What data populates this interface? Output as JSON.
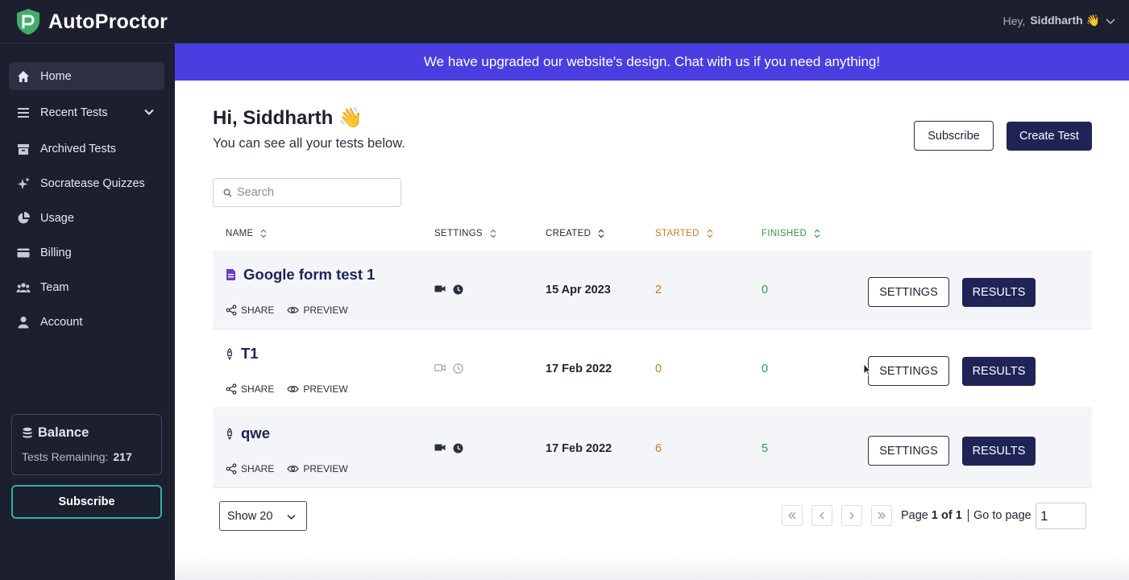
{
  "app": {
    "name": "AutoProctor"
  },
  "user_menu": {
    "greeting_prefix": "Hey,",
    "name": "Siddharth 👋"
  },
  "sidebar": {
    "items": [
      {
        "label": "Home",
        "icon": "home-icon",
        "active": true
      },
      {
        "label": "Recent Tests",
        "icon": "list-icon"
      },
      {
        "label": "Archived Tests",
        "icon": "archive-icon"
      },
      {
        "label": "Socratease Quizzes",
        "icon": "sparkle-icon"
      },
      {
        "label": "Usage",
        "icon": "pie-chart-icon"
      },
      {
        "label": "Billing",
        "icon": "credit-card-icon"
      },
      {
        "label": "Team",
        "icon": "team-icon"
      },
      {
        "label": "Account",
        "icon": "user-icon"
      }
    ],
    "balance": {
      "title": "Balance",
      "remaining_label": "Tests Remaining:",
      "remaining_value": "217"
    },
    "subscribe_label": "Subscribe"
  },
  "announcement": "We have upgraded our website's design. Chat with us if you need anything!",
  "main": {
    "greeting": "Hi, Siddharth 👋",
    "subtitle": "You can see all your tests below.",
    "subscribe_label": "Subscribe",
    "create_test_label": "Create Test",
    "search_placeholder": "Search"
  },
  "table": {
    "headers": {
      "name": "NAME",
      "settings": "SETTINGS",
      "created": "CREATED",
      "started": "STARTED",
      "finished": "FINISHED"
    },
    "share_label": "SHARE",
    "preview_label": "PREVIEW",
    "settings_btn": "SETTINGS",
    "results_btn": "RESULTS",
    "rows": [
      {
        "name": "Google form test 1",
        "icon": "google-form-icon",
        "created": "15 Apr 2023",
        "started": "2",
        "finished": "0",
        "camera_on": true
      },
      {
        "name": "T1",
        "icon": "rocket-icon",
        "created": "17 Feb 2022",
        "started": "0",
        "finished": "0",
        "camera_on": false
      },
      {
        "name": "qwe",
        "icon": "rocket-icon",
        "created": "17 Feb 2022",
        "started": "6",
        "finished": "5",
        "camera_on": true
      }
    ]
  },
  "pagination": {
    "show_label": "Show 20",
    "page_prefix": "Page",
    "page_of": "1 of 1",
    "goto_label": "Go to page",
    "goto_value": "1"
  },
  "colors": {
    "sidebar_bg": "#1c1f2e",
    "announce_bg": "#4b3ee0",
    "primary": "#1f2355",
    "started": "#c47d1c",
    "finished": "#2f9a3f"
  }
}
